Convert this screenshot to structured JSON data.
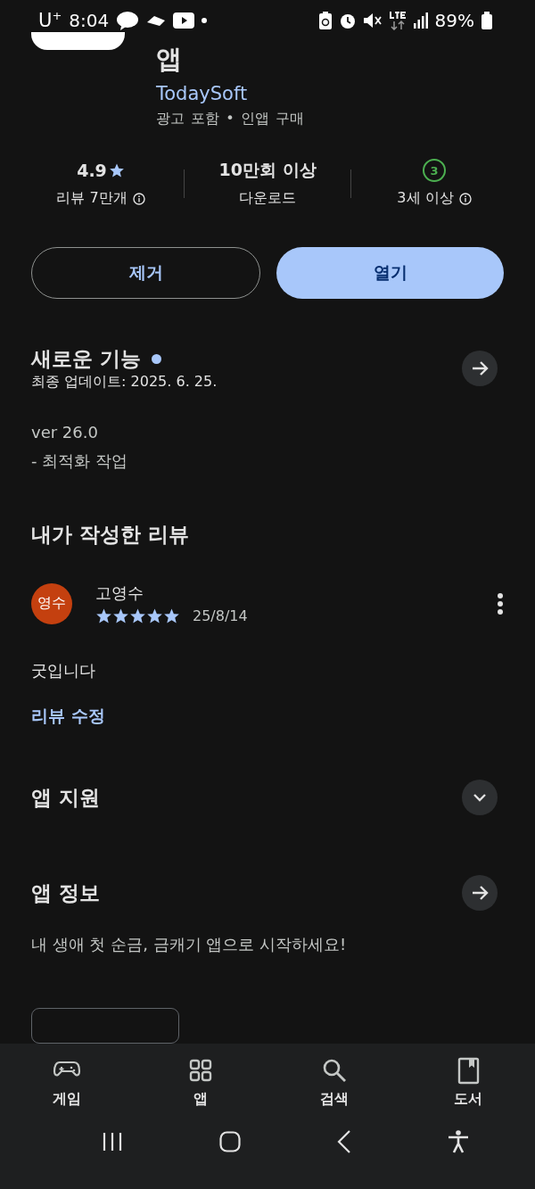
{
  "status_bar": {
    "carrier": "U$^{+}$",
    "time": "8:04",
    "battery": "89%"
  },
  "app": {
    "title": "앱",
    "developer": "TodaySoft",
    "meta": "광고 포함 • 인앱 구매"
  },
  "stats": [
    {
      "kind": "rating",
      "value": "4.9",
      "label": "리뷰 7만개"
    },
    {
      "kind": "downloads",
      "value": "10만회 이상",
      "label": "다운로드"
    },
    {
      "kind": "age",
      "value": "3",
      "label": "3세 이상"
    }
  ],
  "buttons": [
    {
      "kind": "outline",
      "label": "제거"
    },
    {
      "kind": "filled",
      "label": "열기"
    }
  ],
  "whats_new": {
    "title": "새로운 기능",
    "updated": "최종 업데이트: 2025. 6. 25.",
    "notes": [
      "ver 26.0",
      "- 최적화 작업"
    ]
  },
  "my_review": {
    "title": "내가 작성한 리뷰",
    "avatar": "영수",
    "name": "고영수",
    "stars": 5,
    "date": "25/8/14",
    "text": "굿입니다",
    "edit_link": "리뷰 수정"
  },
  "support": {
    "title": "앱 지원",
    "expanded": false
  },
  "about": {
    "title": "앱 정보",
    "description": "내 생애 첫 순금, 금캐기 앱으로 시작하세요!"
  },
  "bottom_nav": [
    {
      "kind": "games",
      "label": "게임"
    },
    {
      "kind": "apps",
      "label": "앱"
    },
    {
      "kind": "search",
      "label": "검색"
    },
    {
      "kind": "books",
      "label": "도서"
    }
  ]
}
